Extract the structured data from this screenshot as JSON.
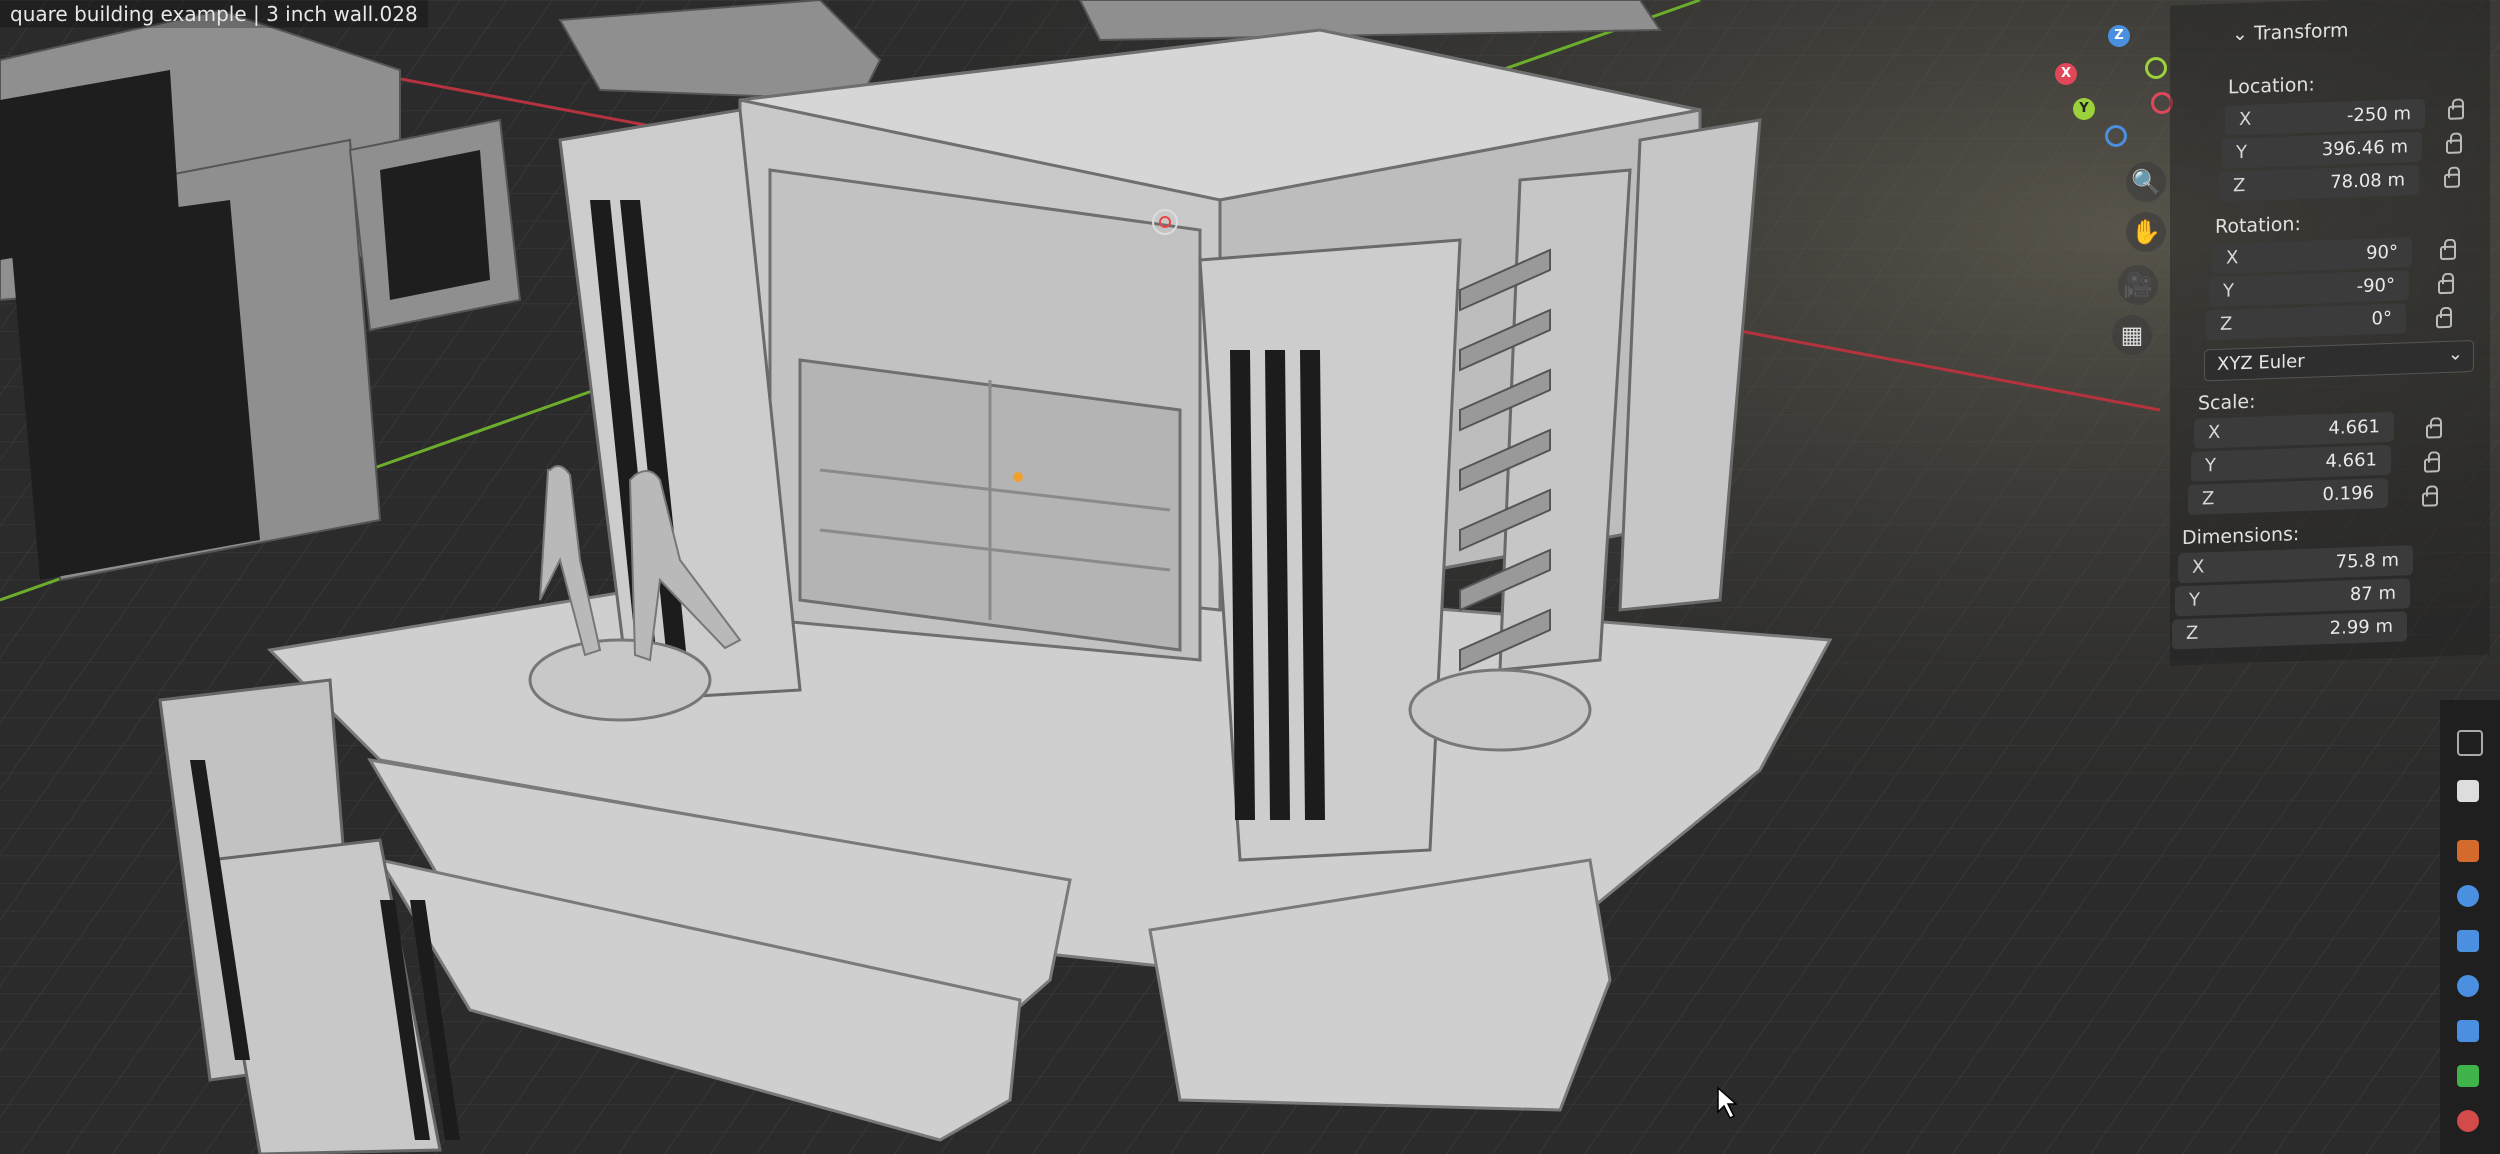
{
  "window": {
    "title": "quare building example | 3 inch wall.028"
  },
  "gizmo": {
    "z": "Z",
    "x": "X",
    "y": "Y",
    "colors": {
      "x": "#e0485a",
      "y": "#9bd13a",
      "z": "#4a8fe0"
    }
  },
  "nav_tools": [
    {
      "icon": "zoom-icon",
      "glyph": "🔍"
    },
    {
      "icon": "hand-pan-icon",
      "glyph": "✋"
    },
    {
      "icon": "camera-icon",
      "glyph": "🎥"
    },
    {
      "icon": "grid-view-icon",
      "glyph": "▦"
    }
  ],
  "transform": {
    "header": "Transform",
    "location_label": "Location:",
    "location": [
      {
        "axis": "X",
        "value": "-250 m"
      },
      {
        "axis": "Y",
        "value": "396.46 m"
      },
      {
        "axis": "Z",
        "value": "78.08 m"
      }
    ],
    "rotation_label": "Rotation:",
    "rotation": [
      {
        "axis": "X",
        "value": "90°"
      },
      {
        "axis": "Y",
        "value": "-90°"
      },
      {
        "axis": "Z",
        "value": "0°"
      }
    ],
    "rotation_mode": "XYZ Euler",
    "scale_label": "Scale:",
    "scale": [
      {
        "axis": "X",
        "value": "4.661"
      },
      {
        "axis": "Y",
        "value": "4.661"
      },
      {
        "axis": "Z",
        "value": "0.196"
      }
    ],
    "dimensions_label": "Dimensions:",
    "dimensions": [
      {
        "axis": "X",
        "value": "75.8 m"
      },
      {
        "axis": "Y",
        "value": "87 m"
      },
      {
        "axis": "Z",
        "value": "2.99 m"
      }
    ]
  },
  "props_icons": [
    "tool-icon",
    "render-icon",
    "output-icon",
    "object-icon",
    "modifier-wrench-icon",
    "particles-icon",
    "physics-icon",
    "constraints-icon",
    "data-icon",
    "material-icon"
  ]
}
